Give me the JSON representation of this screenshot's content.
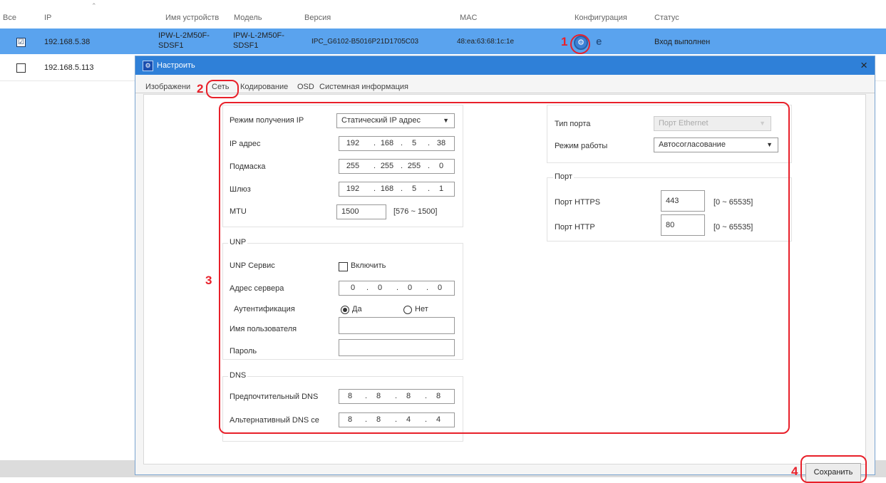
{
  "table": {
    "headers": {
      "all": "Все",
      "ip": "IP",
      "device_name": "Имя устройств",
      "model": "Модель",
      "version": "Версия",
      "mac": "MAC",
      "config": "Конфигурация",
      "status": "Статус"
    },
    "sort_icon": "chevron-up-icon",
    "rows": [
      {
        "checked": "☑",
        "ip": "192.168.5.38",
        "name_line1": "IPW-L-2M50F-",
        "name_line2": "SDSF1",
        "model_line1": "IPW-L-2M50F-",
        "model_line2": "SDSF1",
        "version": "IPC_G6102-B5016P21D1705C03",
        "mac": "48:ea:63:68:1c:1e",
        "status": "Вход выполнен"
      },
      {
        "ip": "192.168.5.113"
      }
    ]
  },
  "annotations": {
    "n1": "1",
    "n2": "2",
    "n3": "3",
    "n4": "4",
    "color": "#e8202a"
  },
  "modal": {
    "title": "Настроить",
    "close": "×",
    "tabs": [
      "Изображени",
      "Сеть",
      "Кодирование",
      "OSD",
      "Системная информация"
    ],
    "network": {
      "ip_mode_label": "Режим получения IP",
      "ip_mode_value": "Статический IP адрес",
      "ip_label": "IP адрес",
      "ip": [
        "192",
        "168",
        "5",
        "38"
      ],
      "mask_label": "Подмаска",
      "mask": [
        "255",
        "255",
        "255",
        "0"
      ],
      "gateway_label": "Шлюз",
      "gateway": [
        "192",
        "168",
        "5",
        "1"
      ],
      "mtu_label": "MTU",
      "mtu_value": "1500",
      "mtu_range": "[576 ~ 1500]"
    },
    "unp": {
      "legend": "UNP",
      "service_label": "UNP Сервис",
      "enable_label": "Включить",
      "server_label": "Адрес сервера",
      "server": [
        "0",
        "0",
        "0",
        "0"
      ],
      "auth_label": "Аутентификация",
      "yes": "Да",
      "no": "Нет",
      "user_label": "Имя пользователя",
      "user_value": "",
      "password_label": "Пароль",
      "password_value": ""
    },
    "dns": {
      "legend": "DNS",
      "preferred_label": "Предпочтительный DNS",
      "preferred": [
        "8",
        "8",
        "8",
        "8"
      ],
      "alternate_label": "Альтернативный DNS се",
      "alternate": [
        "8",
        "8",
        "4",
        "4"
      ]
    },
    "port_section": {
      "type_label": "Тип порта",
      "type_value": "Порт Ethernet",
      "mode_label": "Режим работы",
      "mode_value": "Автосогласование",
      "legend": "Порт",
      "https_label": "Порт HTTPS",
      "https_value": "443",
      "https_range": "[0 ~ 65535]",
      "http_label": "Порт HTTP",
      "http_value": "80",
      "http_range": "[0 ~ 65535]"
    },
    "save": "Сохранить"
  }
}
